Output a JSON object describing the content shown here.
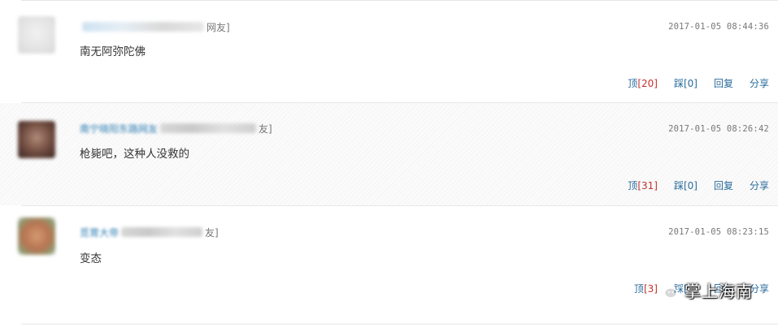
{
  "comments": [
    {
      "user_name": "海南网友用户",
      "user_suffix": "网友]",
      "timestamp": "2017-01-05 08:44:36",
      "content": "南无阿弥陀佛",
      "actions": {
        "up_label": "顶",
        "up_count": "[20]",
        "down_label": "踩",
        "down_count": "[0]",
        "reply": "回复",
        "share": "分享"
      }
    },
    {
      "user_name": "南宁晓阳东路网友",
      "user_suffix": "友]",
      "timestamp": "2017-01-05 08:26:42",
      "content": "枪毙吧，这种人没救的",
      "actions": {
        "up_label": "顶",
        "up_count": "[31]",
        "down_label": "踩",
        "down_count": "[0]",
        "reply": "回复",
        "share": "分享"
      }
    },
    {
      "user_name": "觅胃大帝",
      "user_suffix": "友]",
      "timestamp": "2017-01-05 08:23:15",
      "content": "变态",
      "actions": {
        "up_label": "顶",
        "up_count": "[3]",
        "down_label": "踩",
        "down_count": "[0]",
        "reply": "回复",
        "share": "分享"
      }
    }
  ],
  "watermark": {
    "text": "掌上海南",
    "icon": "wechat-icon"
  },
  "colors": {
    "link": "#2a6b9c",
    "count_red": "#c4302b",
    "username": "#2f7fb3",
    "time": "#777777"
  }
}
